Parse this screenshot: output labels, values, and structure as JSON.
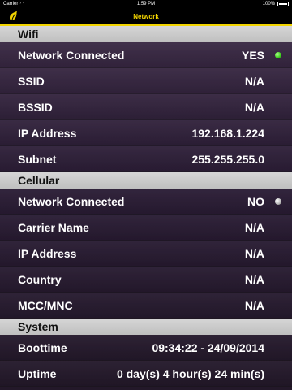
{
  "status_bar": {
    "carrier": "Carrier",
    "wifi_icon": "wifi-icon",
    "time": "1:59 PM",
    "battery_percent": "100%",
    "battery_icon": "battery-icon"
  },
  "nav": {
    "title": "Network",
    "logo_icon": "logo-icon",
    "accent_color": "#f2d400"
  },
  "sections": {
    "wifi": {
      "title": "Wifi",
      "rows": [
        {
          "label": "Network Connected",
          "value": "YES",
          "indicator": "green"
        },
        {
          "label": "SSID",
          "value": "N/A"
        },
        {
          "label": "BSSID",
          "value": "N/A"
        },
        {
          "label": "IP Address",
          "value": "192.168.1.224"
        },
        {
          "label": "Subnet",
          "value": "255.255.255.0"
        }
      ]
    },
    "cellular": {
      "title": "Cellular",
      "rows": [
        {
          "label": "Network Connected",
          "value": "NO",
          "indicator": "gray"
        },
        {
          "label": "Carrier Name",
          "value": "N/A"
        },
        {
          "label": "IP Address",
          "value": "N/A"
        },
        {
          "label": "Country",
          "value": "N/A"
        },
        {
          "label": "MCC/MNC",
          "value": "N/A"
        }
      ]
    },
    "system": {
      "title": "System",
      "rows": [
        {
          "label": "Boottime",
          "value": "09:34:22 - 24/09/2014"
        },
        {
          "label": "Uptime",
          "value": "0 day(s) 4 hour(s) 24 min(s)"
        }
      ]
    }
  },
  "colors": {
    "indicator_on": "#3ed11e",
    "indicator_off": "#bdbdbd",
    "section_header_bg": "#cccccc"
  }
}
